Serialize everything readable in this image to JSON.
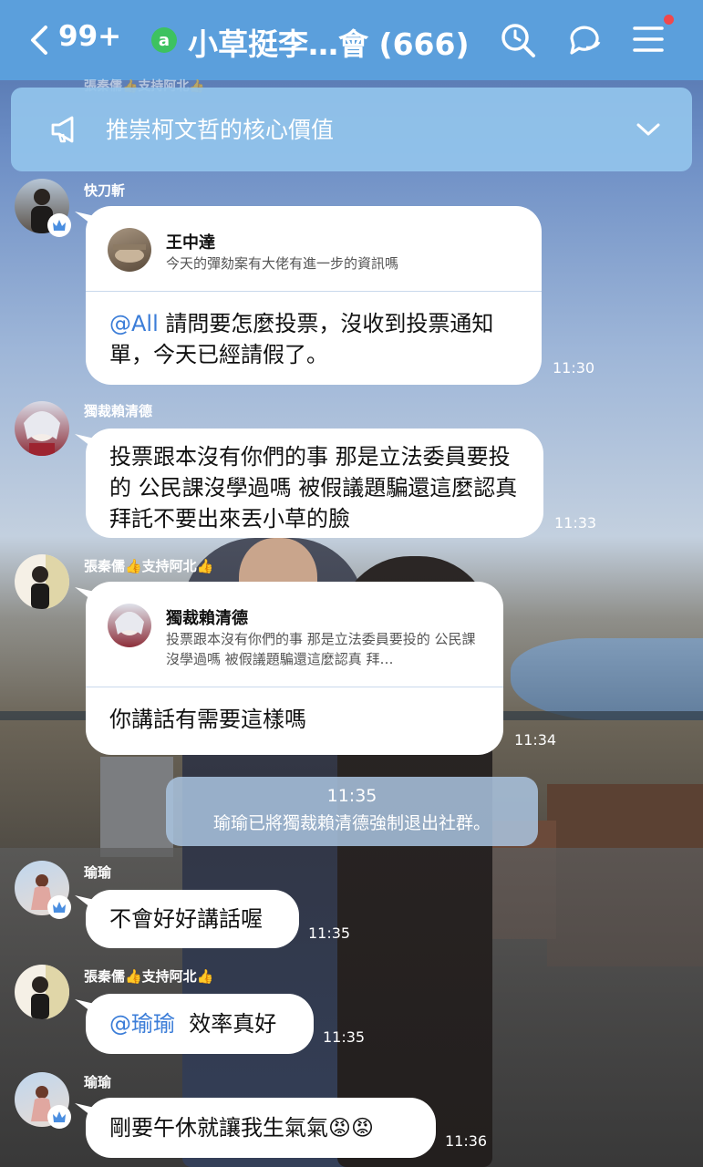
{
  "topbar": {
    "back_count": "99+",
    "group_badge": "a",
    "title": "小草挺李…會 (666)"
  },
  "announcement": {
    "peek_text": "張秦儒👍支持阿北👍",
    "text": "推崇柯文哲的核心價值"
  },
  "messages": [
    {
      "sender": "快刀斬",
      "reply": {
        "name": "王中達",
        "text": "今天的彈劾案有大佬有進一步的資訊嗎"
      },
      "mention": "@All",
      "text_rest": " 請問要怎麼投票，沒收到投票通知單，今天已經請假了。",
      "time": "11:30"
    },
    {
      "sender": "獨裁賴清德",
      "text": "投票跟本沒有你們的事 那是立法委員要投的 公民課沒學過嗎 被假議題騙還這麼認真 拜託不要出來丟小草的臉",
      "time": "11:33"
    },
    {
      "sender": "張秦儒👍支持阿北👍",
      "reply": {
        "name": "獨裁賴清德",
        "text": "投票跟本沒有你們的事 那是立法委員要投的 公民課沒學過嗎 被假議題騙還這麼認真 拜…"
      },
      "text": "你講話有需要這樣嗎",
      "time": "11:34"
    },
    {
      "sender": "瑜瑜",
      "text": "不會好好講話喔",
      "time": "11:35"
    },
    {
      "sender": "張秦儒👍支持阿北👍",
      "mention": "@瑜瑜",
      "text_rest": "  效率真好",
      "time": "11:35"
    },
    {
      "sender": "瑜瑜",
      "text": "剛要午休就讓我生氣氣😡😡",
      "time": "11:36"
    }
  ],
  "system": {
    "time": "11:35",
    "text": "瑜瑜已將獨裁賴清德強制退出社群。"
  },
  "colors": {
    "topbar": "#5b9fdc",
    "announcement": "#92c4ec",
    "mention": "#3b7dd8",
    "group_badge": "#3dc260",
    "notification_dot": "#f0484c"
  }
}
